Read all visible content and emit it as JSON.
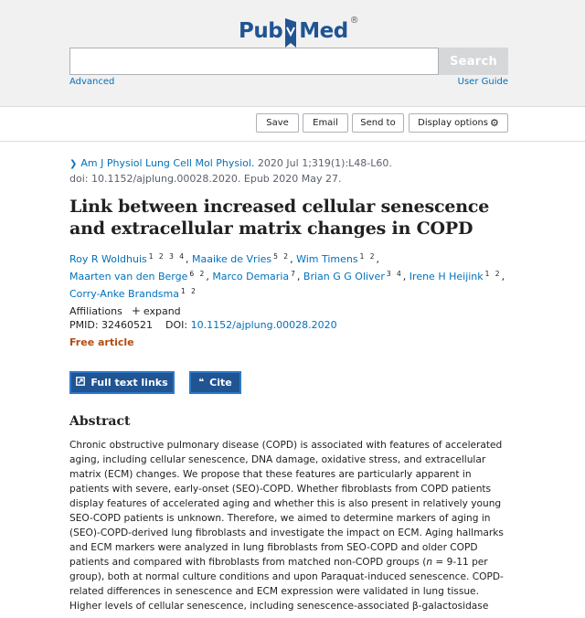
{
  "header": {
    "logo_left": "Pub",
    "logo_right": "Med",
    "logo_reg": "®",
    "search_placeholder": "",
    "search_button": "Search",
    "advanced": "Advanced",
    "user_guide": "User Guide",
    "brand_color": "#205493"
  },
  "toolbar": {
    "save": "Save",
    "email": "Email",
    "send_to": "Send to",
    "display_options": "Display options",
    "display_icon": "gear-icon"
  },
  "article": {
    "journal": "Am J Physiol Lung Cell Mol Physiol.",
    "pub_info": " 2020 Jul 1;319(1):L48-L60.",
    "doi_line": "doi: 10.1152/ajplung.00028.2020. Epub 2020 May 27.",
    "title": "Link between increased cellular senescence and extracellular matrix changes in COPD",
    "authors": [
      {
        "name": "Roy R Woldhuis",
        "aff": "1 2 3 4"
      },
      {
        "name": "Maaike de Vries",
        "aff": "5 2"
      },
      {
        "name": "Wim Timens",
        "aff": "1 2"
      },
      {
        "name": "Maarten van den Berge",
        "aff": "6 2"
      },
      {
        "name": "Marco Demaria",
        "aff": "7"
      },
      {
        "name": "Brian G G Oliver",
        "aff": "3 4"
      },
      {
        "name": "Irene H Heijink",
        "aff": "1 2"
      },
      {
        "name": "Corry-Anke Brandsma",
        "aff": "1 2"
      }
    ],
    "affiliations_label": "Affiliations",
    "expand_label": "expand",
    "pmid_label": "PMID:",
    "pmid": "32460521",
    "doi_label": "DOI:",
    "doi": "10.1152/ajplung.00028.2020",
    "free_article": "Free article",
    "free_color": "#b24c13"
  },
  "actions": {
    "full_text": "Full text links",
    "cite": "Cite"
  },
  "abstract": {
    "heading": "Abstract",
    "p1": "Chronic obstructive pulmonary disease (COPD) is associated with features of accelerated aging, including cellular senescence, DNA damage, oxidative stress, and extracellular matrix (ECM) changes. We propose that these features are particularly apparent in patients with severe, early-onset (SEO)-COPD. Whether fibroblasts from COPD patients display features of accelerated aging and whether this is also present in relatively young SEO-COPD patients is unknown. Therefore, we aimed to determine markers of aging in (SEO)-COPD-derived lung fibroblasts and investigate the impact on ECM. Aging hallmarks and ECM markers were analyzed in lung fibroblasts from SEO-COPD and older COPD patients and compared with fibroblasts from matched non-COPD groups (",
    "n_italic": "n",
    "p2": " = 9-11 per group), both at normal culture conditions and upon Paraquat-induced senescence. COPD-related differences in senescence and ECM expression were validated in lung tissue. Higher levels of cellular senescence, including senescence-associated β-galactosidase"
  }
}
